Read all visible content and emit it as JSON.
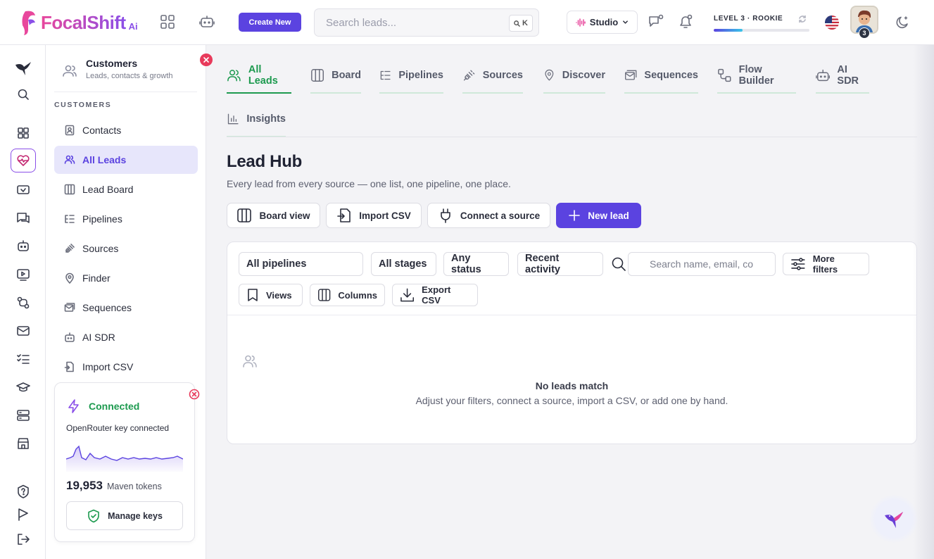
{
  "brand": {
    "name": "FocalShift",
    "suffix": "Ai"
  },
  "header": {
    "create_label": "Create New",
    "search_placeholder": "Search leads...",
    "search_shortcut": "K",
    "studio_label": "Studio",
    "level_label": "LEVEL 3 · ROOKIE",
    "level_progress": 0.3,
    "avatar_badge": "3"
  },
  "rail": {
    "items": [
      "logo-bird-icon",
      "search-icon",
      "dashboard-icon",
      "heart-pulse-icon",
      "media-icon",
      "chat-icon",
      "bot-icon",
      "video-icon",
      "flow-icon",
      "mail-icon",
      "checklist-icon",
      "graduation-icon",
      "server-icon",
      "store-icon",
      "help-icon",
      "flag-icon",
      "logout-icon"
    ],
    "active": "heart-pulse-icon"
  },
  "subnav": {
    "title": "Customers",
    "subtitle": "Leads, contacts & growth",
    "section": "CUSTOMERS",
    "items": [
      {
        "label": "Contacts",
        "icon": "contact-icon"
      },
      {
        "label": "All Leads",
        "icon": "users-icon",
        "active": true
      },
      {
        "label": "Lead Board",
        "icon": "columns-icon"
      },
      {
        "label": "Pipelines",
        "icon": "pipeline-icon"
      },
      {
        "label": "Sources",
        "icon": "plug-icon"
      },
      {
        "label": "Finder",
        "icon": "pin-icon"
      },
      {
        "label": "Sequences",
        "icon": "mail-stack-icon"
      },
      {
        "label": "AI SDR",
        "icon": "bot-icon"
      },
      {
        "label": "Import CSV",
        "icon": "import-icon"
      }
    ]
  },
  "connection": {
    "status": "Connected",
    "description": "OpenRouter key connected",
    "tokens_value": "19,953",
    "tokens_label": "Maven tokens",
    "manage_label": "Manage keys"
  },
  "tabs": [
    {
      "label": "All Leads",
      "icon": "users-icon",
      "active": true
    },
    {
      "label": "Board",
      "icon": "columns-icon"
    },
    {
      "label": "Pipelines",
      "icon": "pipeline-icon"
    },
    {
      "label": "Sources",
      "icon": "plug-icon"
    },
    {
      "label": "Discover",
      "icon": "pin-icon"
    },
    {
      "label": "Sequences",
      "icon": "mail-stack-icon"
    },
    {
      "label": "Flow Builder",
      "icon": "flow-icon"
    },
    {
      "label": "AI SDR",
      "icon": "bot-icon"
    },
    {
      "label": "Insights",
      "icon": "chart-icon"
    }
  ],
  "page": {
    "title": "Lead Hub",
    "subtitle": "Every lead from every source — one list, one pipeline, one place."
  },
  "actions": {
    "board_view": "Board view",
    "import_csv": "Import CSV",
    "connect_source": "Connect a source",
    "new_lead": "New lead"
  },
  "filters": {
    "pipeline": "All pipelines",
    "stage": "All stages",
    "status": "Any status",
    "sort": "Recent activity",
    "search_placeholder": "Search name, email, co",
    "more_filters": "More filters",
    "views": "Views",
    "columns": "Columns",
    "export_csv": "Export CSV"
  },
  "empty": {
    "title": "No leads match",
    "message": "Adjust your filters, connect a source, import a CSV, or add one by hand."
  },
  "colors": {
    "accent": "#5b43e0",
    "success": "#1d9a4f",
    "brand_pink": "#e8479c",
    "danger": "#e83a5b"
  }
}
